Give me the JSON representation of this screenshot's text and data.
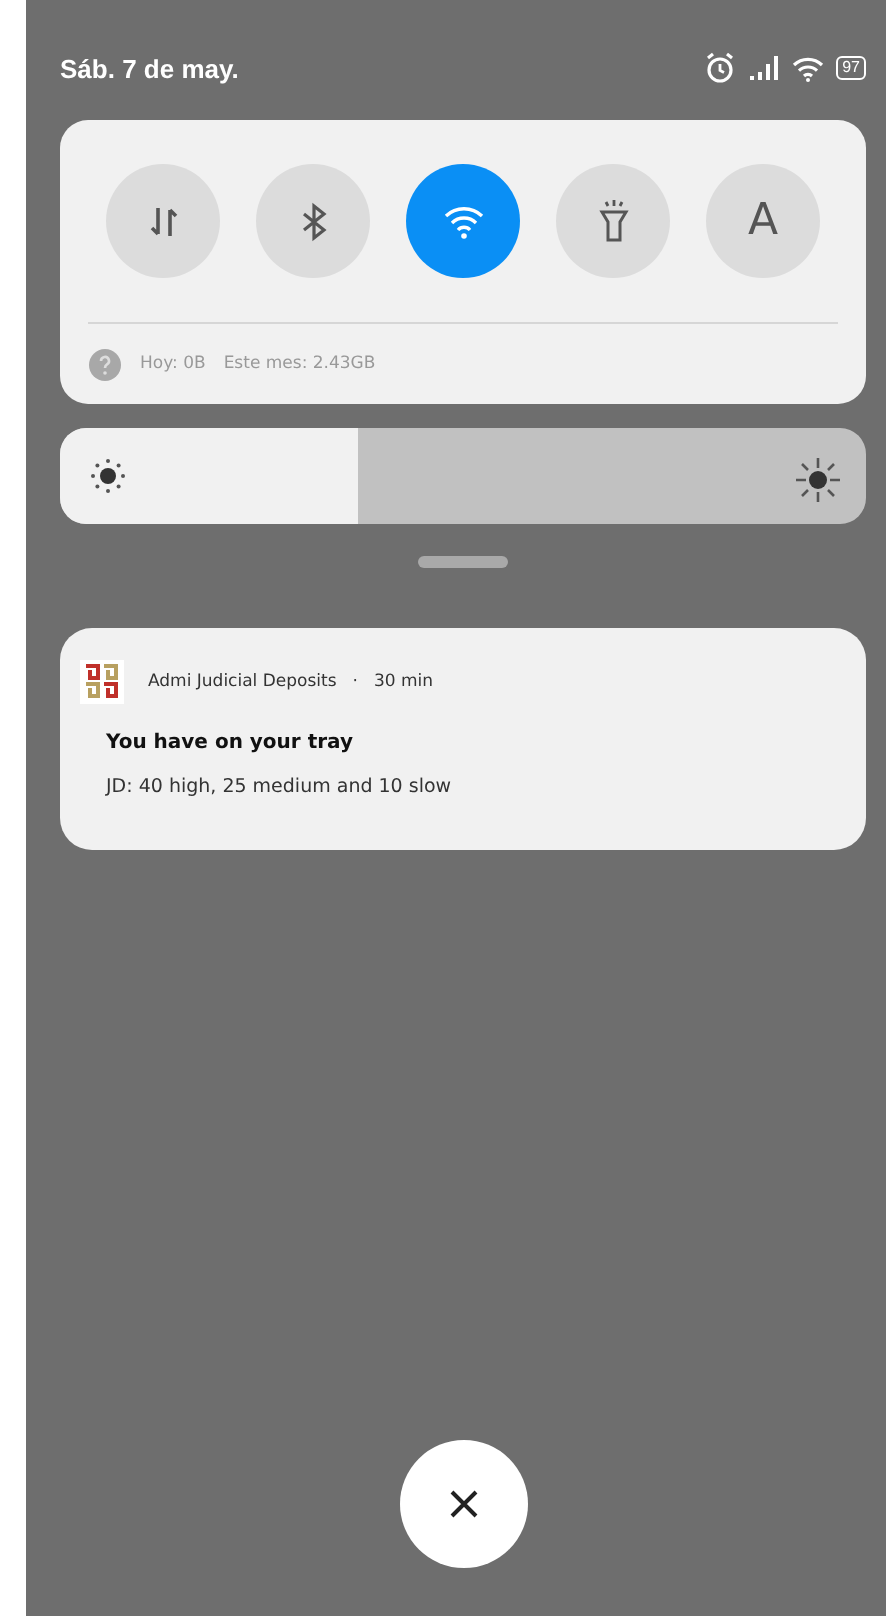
{
  "status_bar": {
    "date": "Sáb. 7 de may.",
    "battery": "97"
  },
  "quick_settings": {
    "toggles": [
      {
        "kind": "data",
        "on": false
      },
      {
        "kind": "bluetooth",
        "on": false
      },
      {
        "kind": "wifi",
        "on": true
      },
      {
        "kind": "flashlight",
        "on": false
      },
      {
        "kind": "letter",
        "label": "A",
        "on": false
      }
    ],
    "usage": {
      "today": "Hoy: 0B",
      "month": "Este mes: 2.43GB"
    }
  },
  "brightness": {
    "level": 0.37
  },
  "notification": {
    "app": "Admi Judicial Deposits",
    "time": "30 min",
    "separator": "·",
    "title": "You have on your tray",
    "body": "JD: 40 high, 25 medium and 10 slow"
  }
}
